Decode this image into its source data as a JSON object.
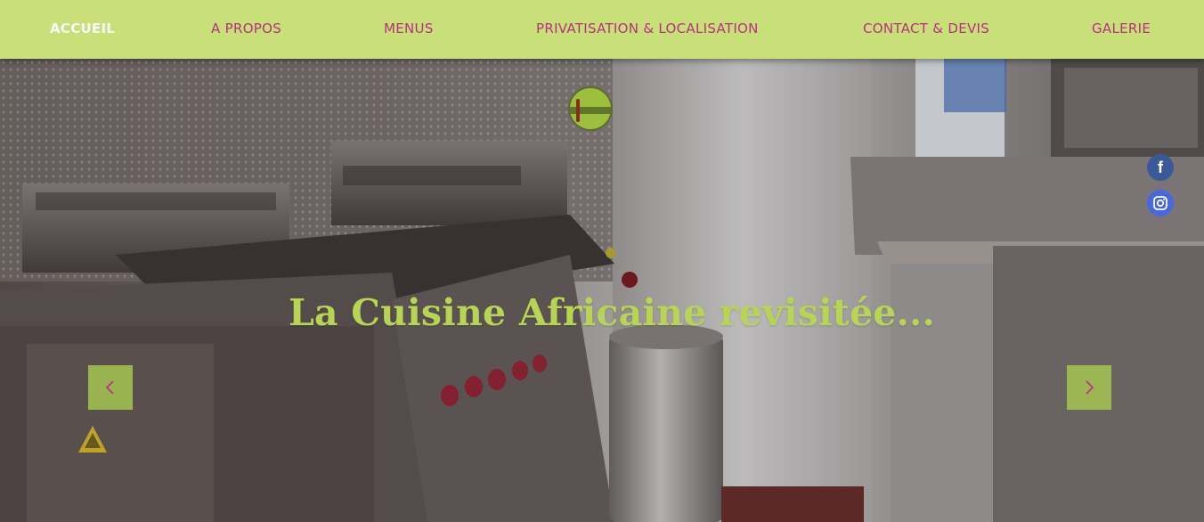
{
  "nav": {
    "items": [
      {
        "label": "ACCUEIL",
        "active": true
      },
      {
        "label": "A PROPOS",
        "active": false
      },
      {
        "label": "MENUS",
        "active": false
      },
      {
        "label": "PRIVATISATION & LOCALISATION",
        "active": false
      },
      {
        "label": "CONTACT & DEVIS",
        "active": false
      },
      {
        "label": "GALERIE",
        "active": false
      }
    ]
  },
  "hero": {
    "headline": "La Cuisine Africaine revisitée...",
    "prev_icon": "chevron-left-icon",
    "next_icon": "chevron-right-icon"
  },
  "social": [
    {
      "icon": "facebook-icon",
      "color": "#3b5998"
    },
    {
      "icon": "instagram-icon",
      "color": "#4a67e0"
    }
  ],
  "colors": {
    "nav_background": "#c9df7a",
    "nav_text": "#b5337c",
    "nav_active_text": "#ffffff",
    "headline": "#b8d456",
    "arrow_button": "#a6c452"
  }
}
